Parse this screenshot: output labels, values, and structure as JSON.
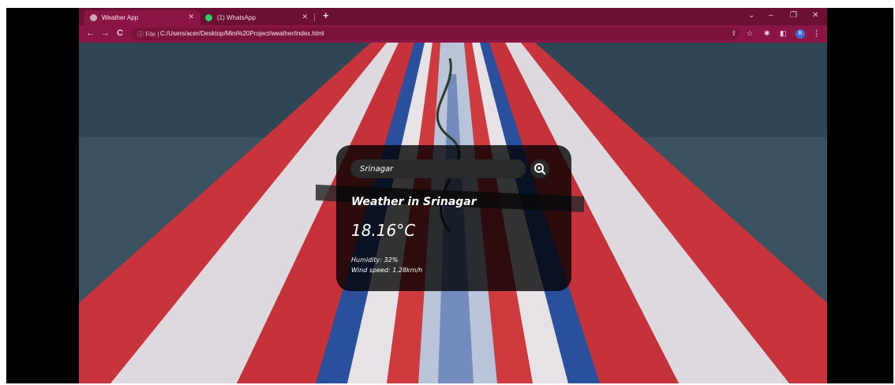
{
  "browser": {
    "tabs": [
      {
        "title": "Weather App",
        "active": true
      },
      {
        "title": "(1) WhatsApp",
        "active": false
      }
    ],
    "new_tab": "+",
    "window_controls": {
      "minimize": "–",
      "restore": "❐",
      "close": "✕",
      "dropdown": "⌄"
    },
    "nav": {
      "back": "←",
      "forward": "→",
      "reload": "C"
    },
    "address": {
      "info": "ⓘ File |",
      "url": "C:/Users/acer/Desktop/Mini%20Project/weather/index.html"
    },
    "profile_initial": "B",
    "colors": {
      "tabbar": "#6b0f33",
      "toolbar": "#8b1545"
    }
  },
  "weather": {
    "search_value": "Srinagar",
    "city": "Weather in Srinagar",
    "temperature": "18.16°C",
    "humidity": "Humidity: 32%",
    "wind": "Wind speed: 1.28km/h"
  }
}
